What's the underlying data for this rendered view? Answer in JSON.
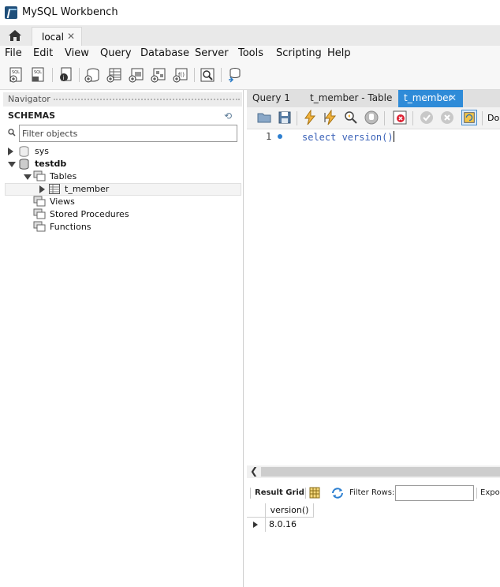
{
  "window": {
    "title": "MySQL Workbench"
  },
  "connection_tab": {
    "label": "local",
    "close": "✕"
  },
  "menu": [
    "File",
    "Edit",
    "View",
    "Query",
    "Database",
    "Server",
    "Tools",
    "Scripting",
    "Help"
  ],
  "toolbar_icons": [
    "new-sql-tab-icon",
    "open-sql-script-icon",
    "inspector-icon",
    "create-schema-icon",
    "create-table-icon",
    "create-view-icon",
    "create-procedure-icon",
    "create-function-icon",
    "search-table-data-icon",
    "reconnect-icon"
  ],
  "navigator": {
    "title": "Navigator",
    "schemas_label": "SCHEMAS",
    "filter_placeholder": "Filter objects",
    "tree": {
      "sys": "sys",
      "testdb": "testdb",
      "tables": "Tables",
      "t_member": "t_member",
      "views": "Views",
      "stored_procedures": "Stored Procedures",
      "functions": "Functions"
    }
  },
  "editor": {
    "tabs": [
      "Query 1",
      "t_member - Table",
      "t_member"
    ],
    "active_tab_close": "✕",
    "limit_label": "Do",
    "line_number": "1",
    "code": "select version()"
  },
  "result": {
    "result_grid_label": "Result Grid",
    "filter_rows_label": "Filter Rows:",
    "export_label": "Expo",
    "column_header": "version()",
    "cell_value": "8.0.16"
  },
  "colors": {
    "active_tab": "#2e8bd8",
    "keyword": "#3b62b8"
  }
}
